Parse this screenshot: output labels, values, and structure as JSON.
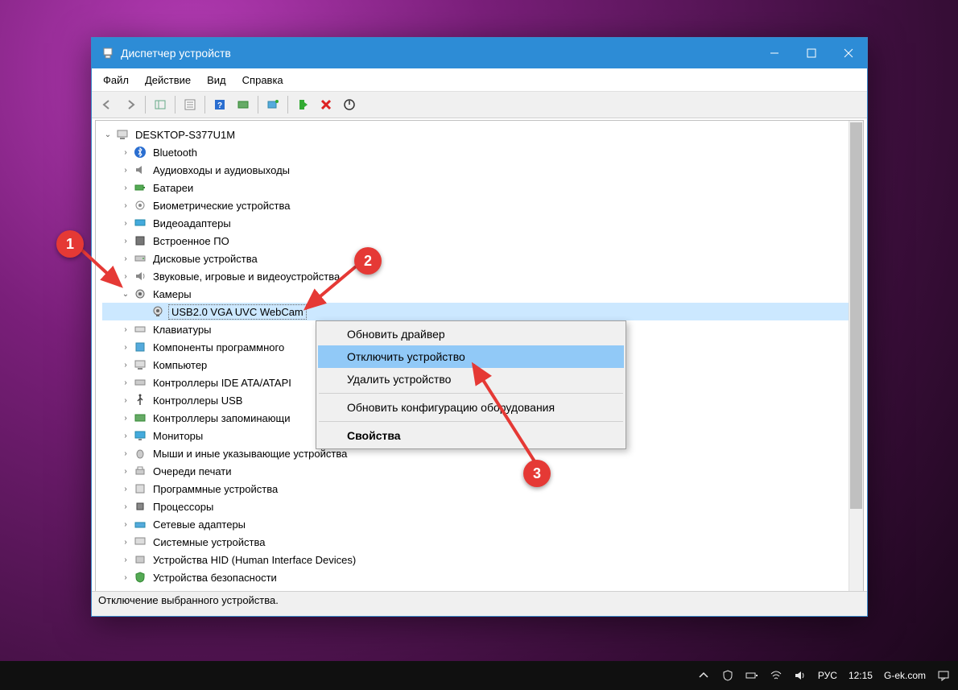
{
  "window": {
    "title": "Диспетчер устройств"
  },
  "menu": {
    "file": "Файл",
    "action": "Действие",
    "view": "Вид",
    "help": "Справка"
  },
  "tree": {
    "root": "DESKTOP-S377U1M",
    "items": [
      "Bluetooth",
      "Аудиовходы и аудиовыходы",
      "Батареи",
      "Биометрические устройства",
      "Видеоадаптеры",
      "Встроенное ПО",
      "Дисковые устройства",
      "Звуковые, игровые и видеоустройства",
      "Камеры",
      "Клавиатуры",
      "Компоненты программного",
      "Компьютер",
      "Контроллеры IDE ATA/ATAPI",
      "Контроллеры USB",
      "Контроллеры запоминающи",
      "Мониторы",
      "Мыши и иные указывающие устройства",
      "Очереди печати",
      "Программные устройства",
      "Процессоры",
      "Сетевые адаптеры",
      "Системные устройства",
      "Устройства HID (Human Interface Devices)",
      "Устройства безопасности"
    ],
    "camera_child": "USB2.0 VGA UVC WebCam"
  },
  "context_menu": {
    "update_driver": "Обновить драйвер",
    "disable": "Отключить устройство",
    "uninstall": "Удалить устройство",
    "scan": "Обновить конфигурацию оборудования",
    "properties": "Свойства"
  },
  "status": "Отключение выбранного устройства.",
  "annotations": {
    "b1": "1",
    "b2": "2",
    "b3": "3"
  },
  "taskbar": {
    "lang": "РУС",
    "time": "12:15",
    "site": "G-ek.com"
  }
}
